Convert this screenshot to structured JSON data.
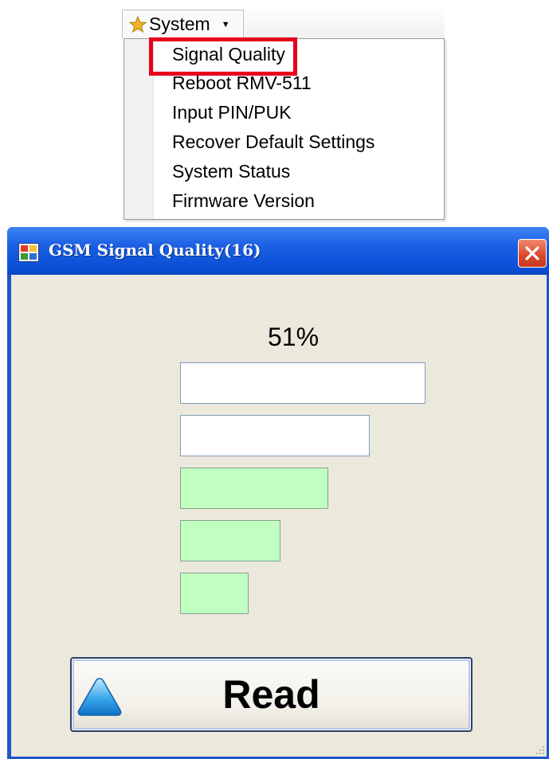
{
  "menu": {
    "title": "System",
    "items": [
      {
        "label": "Signal Quality"
      },
      {
        "label": "Reboot RMV-511"
      },
      {
        "label": "Input PIN/PUK"
      },
      {
        "label": "Recover Default Settings"
      },
      {
        "label": "System Status"
      },
      {
        "label": "Firmware Version"
      }
    ],
    "highlighted_item": "Signal Quality",
    "highlight_color": "#e8001c"
  },
  "dialog": {
    "title": "GSM Signal Quality(16)",
    "signal_percent": "51%",
    "bars_total": 5,
    "bars_lit": 3,
    "bar_on_color": "#c0ffc0",
    "bar_off_color": "#ffffff",
    "read_label": "Read"
  }
}
